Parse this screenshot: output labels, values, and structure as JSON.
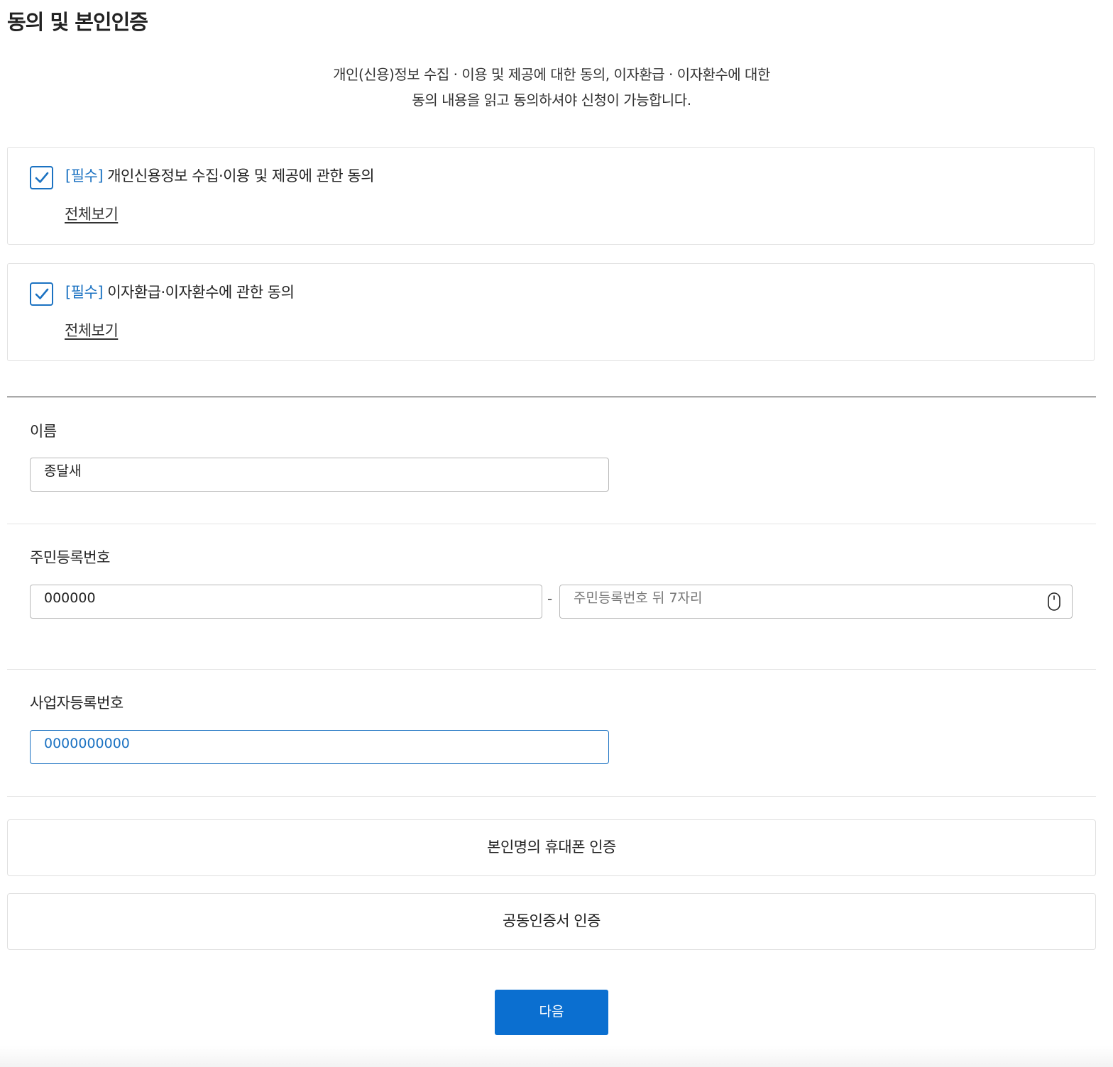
{
  "page": {
    "title": "동의 및 본인인증",
    "intro_line1": "개인(신용)정보 수집 · 이용 및 제공에 대한 동의, 이자환급 · 이자환수에 대한",
    "intro_line2": "동의 내용을 읽고 동의하셔야 신청이 가능합니다."
  },
  "consents": [
    {
      "required_tag": "[필수]",
      "label": " 개인신용정보 수집·이용 및 제공에 관한 동의",
      "checked": true,
      "view_all": "전체보기"
    },
    {
      "required_tag": "[필수]",
      "label": " 이자환급·이자환수에 관한 동의",
      "checked": true,
      "view_all": "전체보기"
    }
  ],
  "form": {
    "name": {
      "label": "이름",
      "value": "종달새"
    },
    "resident_number": {
      "label": "주민등록번호",
      "front_value": "000000",
      "separator": "-",
      "back_placeholder": "주민등록번호 뒤 7자리",
      "back_icon": "mouse-icon"
    },
    "business_number": {
      "label": "사업자등록번호",
      "value": "0000000000"
    }
  },
  "auth": {
    "phone_button": "본인명의 휴대폰 인증",
    "certificate_button": "공동인증서 인증"
  },
  "actions": {
    "next_button": "다음"
  },
  "colors": {
    "accent": "#1b72c2",
    "primary_button": "#0b6fd0",
    "border": "#b8b8b8"
  }
}
